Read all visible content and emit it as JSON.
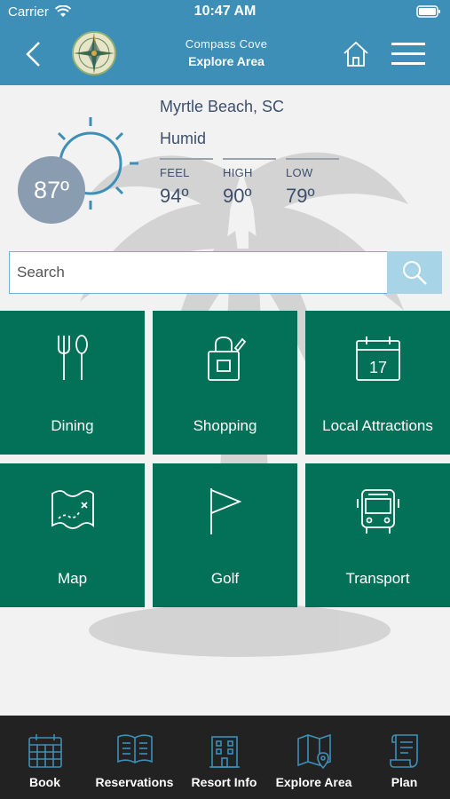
{
  "status": {
    "carrier": "Carrier",
    "time": "10:47 AM"
  },
  "header": {
    "resort_name": "Compass Cove",
    "page_title": "Explore Area"
  },
  "weather": {
    "location": "Myrtle Beach, SC",
    "condition": "Humid",
    "current_temp": "87º",
    "feel_label": "FEEL",
    "feel_value": "94º",
    "high_label": "HIGH",
    "high_value": "90º",
    "low_label": "LOW",
    "low_value": "79º"
  },
  "search": {
    "placeholder": "Search"
  },
  "categories": [
    {
      "label": "Dining",
      "icon": "fork-spoon-icon"
    },
    {
      "label": "Shopping",
      "icon": "shopping-bag-icon"
    },
    {
      "label": "Local Attractions",
      "icon": "calendar-icon"
    },
    {
      "label": "Map",
      "icon": "treasure-map-icon"
    },
    {
      "label": "Golf",
      "icon": "golf-flag-icon"
    },
    {
      "label": "Transport",
      "icon": "bus-icon"
    }
  ],
  "tabs": [
    {
      "label": "Book",
      "icon": "calendar-grid-icon"
    },
    {
      "label": "Reservations",
      "icon": "open-book-icon"
    },
    {
      "label": "Resort Info",
      "icon": "building-icon"
    },
    {
      "label": "Explore Area",
      "icon": "map-pin-icon"
    },
    {
      "label": "Plan",
      "icon": "scroll-icon"
    }
  ],
  "colors": {
    "header": "#3d8fb8",
    "tile": "#037157",
    "tabbar": "#222222",
    "tab_icon": "#3d8fb8",
    "temp_circle": "#8a9cb0"
  }
}
